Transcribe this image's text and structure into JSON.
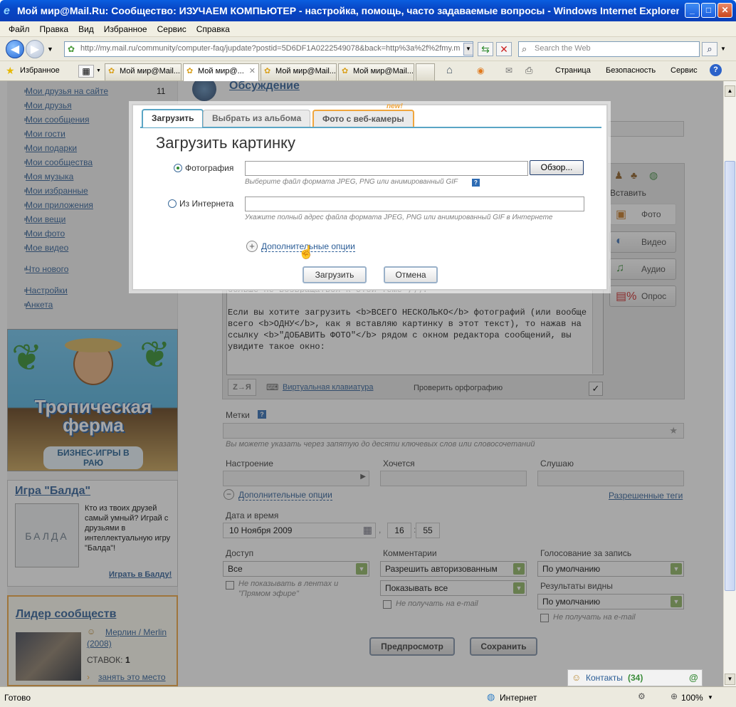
{
  "window": {
    "title": "Мой мир@Mail.Ru: Сообщество: ИЗУЧАЕМ КОМПЬЮТЕР - настройка, помощь, часто задаваемые вопросы - Windows Internet Explorer",
    "minimize": "_",
    "maximize": "□",
    "close": "✕"
  },
  "menu": [
    "Файл",
    "Правка",
    "Вид",
    "Избранное",
    "Сервис",
    "Справка"
  ],
  "address": {
    "url": "http://my.mail.ru/community/computer-faq/jupdate?postid=5D6DF1A0222549078&back=http%3a%2f%2fmy.m",
    "search_placeholder": "Search the Web"
  },
  "favorites_label": "Избранное",
  "tabs": [
    {
      "label": "Мой мир@Mail...."
    },
    {
      "label": "Мой мир@..."
    },
    {
      "label": "Мой мир@Mail...."
    },
    {
      "label": "Мой мир@Mail...."
    }
  ],
  "cmdbar": {
    "page": "Страница",
    "security": "Безопасность",
    "tools": "Сервис"
  },
  "sidebar": {
    "links": [
      {
        "label": "Мои друзья на сайте",
        "count": "11"
      },
      {
        "label": "Мои друзья",
        "count": ""
      },
      {
        "label": "Мои сообщения",
        "count": ""
      },
      {
        "label": "Мои гости",
        "count": ""
      },
      {
        "label": "Мои подарки",
        "count": ""
      },
      {
        "label": "Мои сообщества",
        "count": ""
      },
      {
        "label": "Моя музыка",
        "count": ""
      },
      {
        "label": "Мои избранные",
        "count": ""
      },
      {
        "label": "Мои приложения",
        "count": ""
      },
      {
        "label": "Мои вещи",
        "count": ""
      },
      {
        "label": "Мои фото",
        "count": ""
      },
      {
        "label": "Мое видео",
        "count": ""
      }
    ],
    "whats_new": "Что нового",
    "settings": "Настройки",
    "profile": "Анкета",
    "promo_title": "Тропическая ферма",
    "promo_sub": "БИЗНЕС-ИГРЫ В РАЮ",
    "game_title": "Игра \"Балда\"",
    "game_text": "Кто из твоих друзей самый умный? Играй с друзьями в интеллектуальную игру \"Балда\"!",
    "game_board": "БАЛДА",
    "game_link": "Играть в Балду!",
    "leader_title": "Лидер сообществ",
    "leader_name": "Мерлин / Merlin (2008)",
    "bets_label": "СТАВОК:",
    "bets_value": "1",
    "take_place": "занять это место"
  },
  "main": {
    "heading": "Обсуждение",
    "insert_label": "Вставить",
    "insert_buttons": [
      "Фото",
      "Видео",
      "Аудио",
      "Опрос"
    ],
    "editor_text_top": "больше не возвращаться к этой теме ;)).",
    "editor_text": "Если вы хотите загрузить <b>ВСЕГО НЕСКОЛЬКО</b> фотографий (или вообще всего <b>ОДНУ</b>, как я вставляю картинку в этот текст), то нажав на ссылку <b>\"ДОБАВИТЬ ФОТО\"</b> рядом с окном редактора сообщений, вы увидите такое окно:",
    "keyboard_btn": "Z→Я",
    "virtual_keyboard": "Виртуальная клавиатура",
    "spellcheck": "Проверить орфографию",
    "tags_label": "Метки",
    "tags_hint": "Вы можете указать через запятую до десяти ключевых слов или словосочетаний",
    "mood_label": "Настроение",
    "want_label": "Хочется",
    "listen_label": "Слушаю",
    "more_options": "Дополнительные опции",
    "allowed_tags": "Разрешенные теги",
    "datetime_label": "Дата и время",
    "date_value": "10 Ноября 2009",
    "hour": "16",
    "minute": "55",
    "access_label": "Доступ",
    "access_value": "Все",
    "access_hint": "Не показывать в лентах и \"Прямом эфире\"",
    "comments_label": "Комментарии",
    "comments_value": "Разрешить авторизованным",
    "comments_show": "Показывать все",
    "comments_hint": "Не получать на e-mail",
    "vote_label": "Голосование за запись",
    "vote_value": "По умолчанию",
    "results_label": "Результаты видны",
    "results_value": "По умолчанию",
    "results_hint": "Не получать на e-mail",
    "preview_btn": "Предпросмотр",
    "save_btn": "Сохранить",
    "contacts_label": "Контакты",
    "contacts_count": "(34)"
  },
  "modal": {
    "tabs": [
      "Загрузить",
      "Выбрать из альбома",
      "Фото с веб-камеры"
    ],
    "new_badge": "new!",
    "title": "Загрузить картинку",
    "opt_photo": "Фотография",
    "browse": "Обзор...",
    "photo_hint": "Выберите файл формата JPEG, PNG или анимированный GIF",
    "opt_internet": "Из Интернета",
    "internet_hint": "Укажите полный адрес файла формата JPEG, PNG или анимированный GIF в Интернете",
    "more_options": "Дополнительные опции",
    "upload_btn": "Загрузить",
    "cancel_btn": "Отмена"
  },
  "status": {
    "left": "Готово",
    "zone": "Интернет",
    "zoom": "100%"
  },
  "colors": {
    "link": "#2a5c96",
    "titlebar": "#0a50d8",
    "accent_green": "#8db45f"
  }
}
